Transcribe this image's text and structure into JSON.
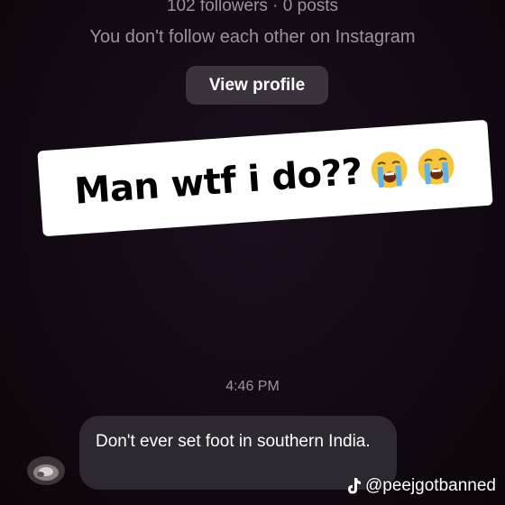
{
  "profile": {
    "followers_line": "102 followers · 0 posts",
    "follow_note": "You don't follow each other on Instagram",
    "view_profile_label": "View profile"
  },
  "caption": {
    "text": "Man wtf i do??",
    "emoji": "loudly-crying-face",
    "emoji_count": 2
  },
  "chat": {
    "timestamp": "4:46 PM",
    "message": "Don't ever set foot in southern India."
  },
  "watermark": {
    "icon": "tiktok-icon",
    "handle": "@peejgotbanned"
  },
  "colors": {
    "background": "#120a14",
    "bubble": "#2e2831",
    "button": "#3a333c",
    "muted_text": "#9a949c",
    "caption_bg": "#ffffff"
  }
}
